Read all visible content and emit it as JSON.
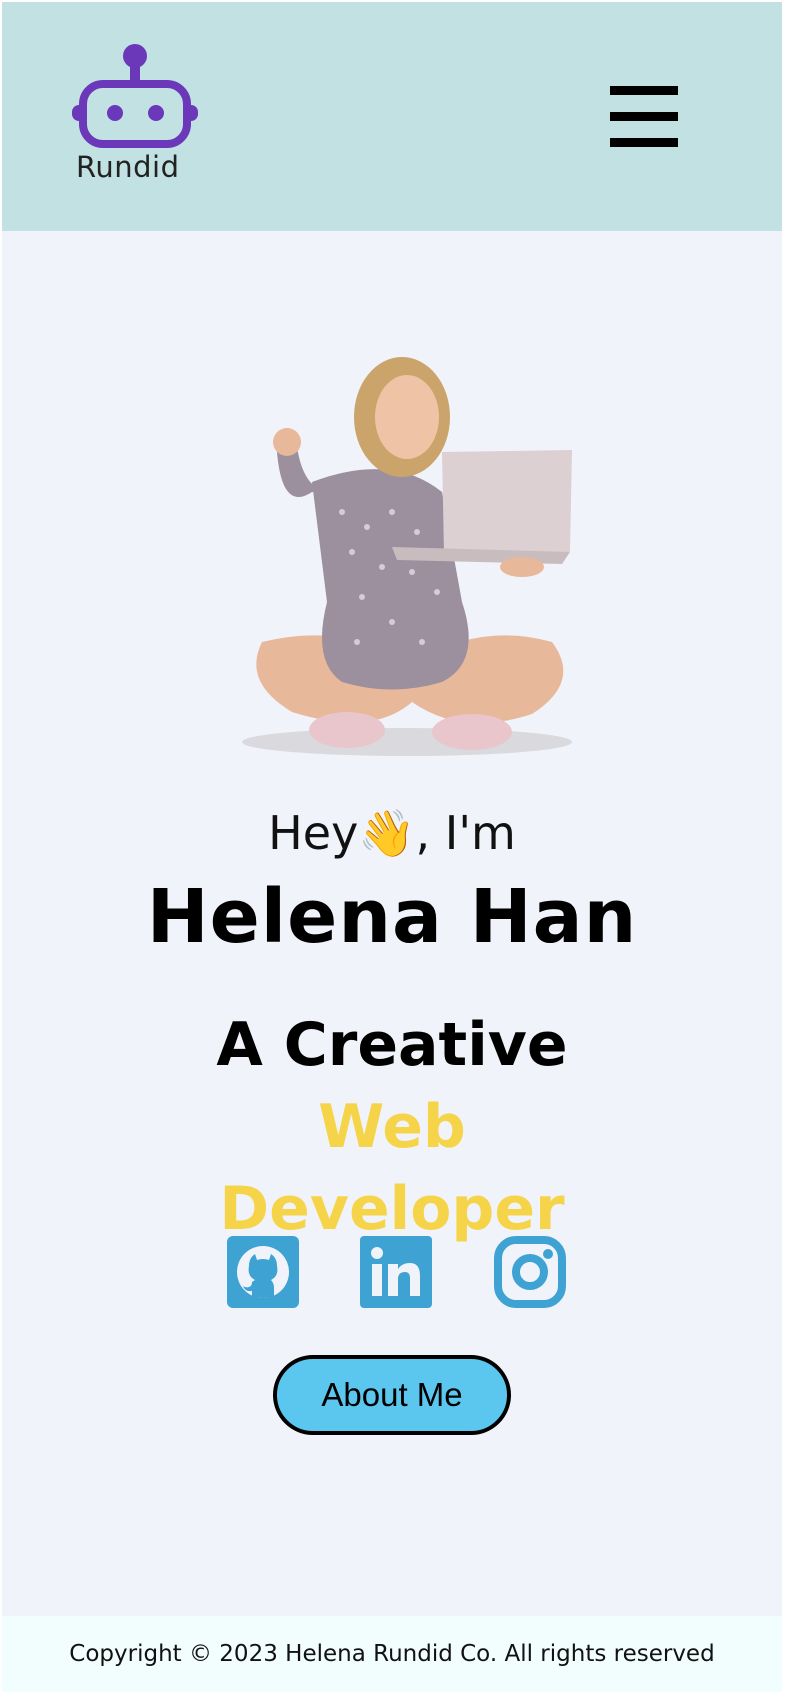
{
  "header": {
    "logo_text": "Rundid",
    "menu_icon": "hamburger-menu-icon"
  },
  "hero": {
    "image": "woman-with-laptop-photo",
    "greeting": "Hey👋, I'm",
    "name": "Helena Han",
    "role_prefix": "A Creative",
    "role_highlight": "Web Developer",
    "highlight_color": "#f6d44a"
  },
  "socials": {
    "items": [
      {
        "icon": "github-icon",
        "label": "GitHub"
      },
      {
        "icon": "linkedin-icon",
        "label": "LinkedIn"
      },
      {
        "icon": "instagram-icon",
        "label": "Instagram"
      }
    ],
    "color": "#3ea2d3"
  },
  "cta": {
    "about_label": "About Me",
    "color": "#5bc6ee"
  },
  "footer": {
    "copyright": "Copyright © 2023 Helena Rundid Co. All rights reserved"
  },
  "colors": {
    "header_bg": "#c2e1e2",
    "page_bg": "#f0f3f9",
    "logo": "#6b38b9"
  }
}
